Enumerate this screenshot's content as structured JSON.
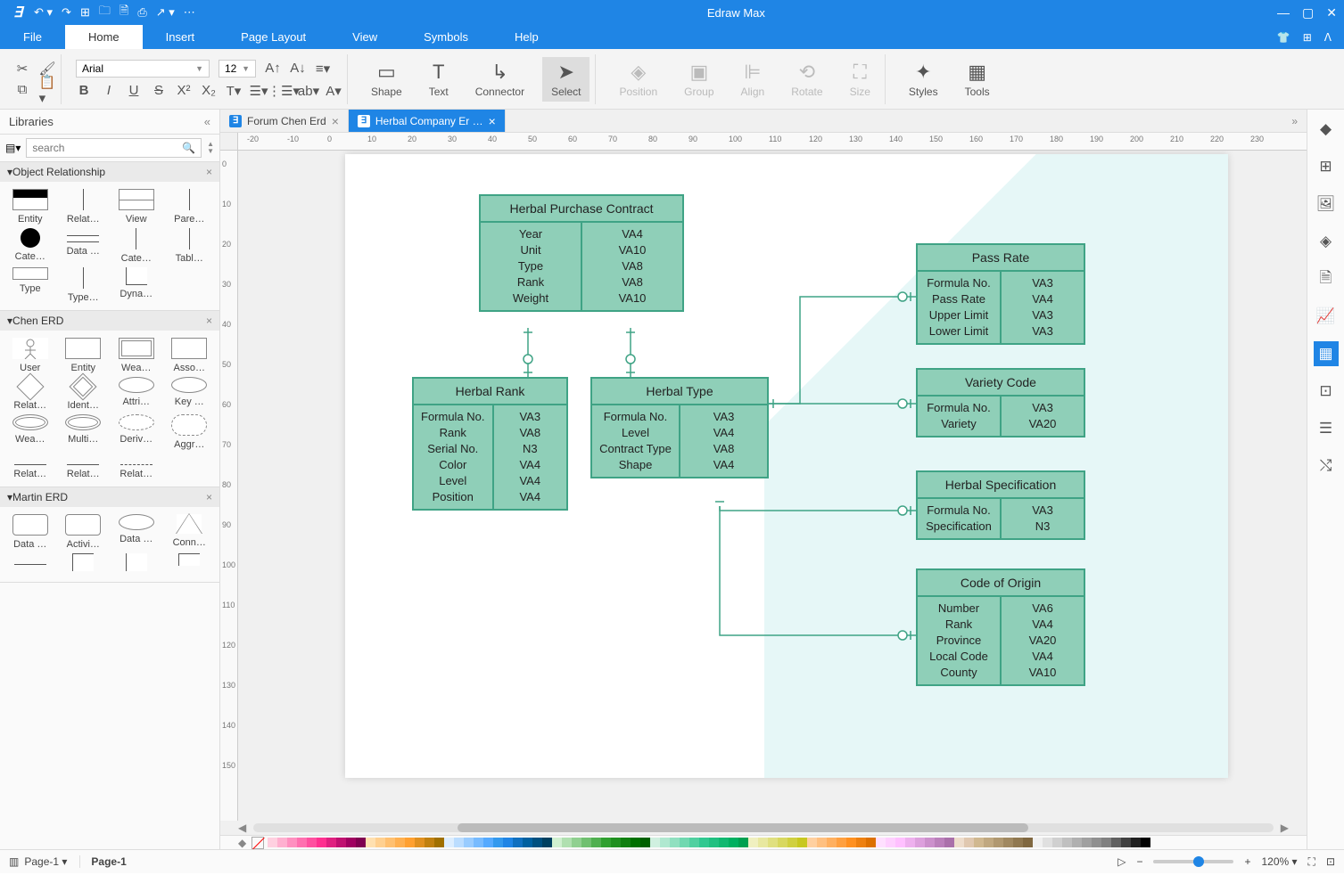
{
  "app_title": "Edraw Max",
  "menus": {
    "file": "File",
    "home": "Home",
    "insert": "Insert",
    "page_layout": "Page Layout",
    "view": "View",
    "symbols": "Symbols",
    "help": "Help"
  },
  "ribbon": {
    "font": "Arial",
    "font_size": "12",
    "shape": "Shape",
    "text": "Text",
    "connector": "Connector",
    "select": "Select",
    "position": "Position",
    "group": "Group",
    "align": "Align",
    "rotate": "Rotate",
    "size": "Size",
    "styles": "Styles",
    "tools": "Tools"
  },
  "libraries": {
    "title": "Libraries",
    "search_placeholder": "search",
    "sections": {
      "object_relationship": {
        "title": "Object Relationship",
        "items": [
          "Entity",
          "Relat…",
          "View",
          "Pare…",
          "Cate…",
          "Data …",
          "Cate…",
          "Tabl…",
          "Type",
          "Type…",
          "Dyna…"
        ]
      },
      "chen_erd": {
        "title": "Chen ERD",
        "items": [
          "User",
          "Entity",
          "Wea…",
          "Asso…",
          "Relat…",
          "Ident…",
          "Attri…",
          "Key …",
          "Wea…",
          "Multi…",
          "Deriv…",
          "Aggr…",
          "Relat…",
          "Relat…",
          "Relat…"
        ]
      },
      "martin_erd": {
        "title": "Martin ERD",
        "items": [
          "Data …",
          "Activi…",
          "Data …",
          "Conn…"
        ]
      }
    }
  },
  "doc_tabs": [
    {
      "label": "Forum Chen Erd",
      "active": false
    },
    {
      "label": "Herbal Company Er …",
      "active": true
    }
  ],
  "ruler_h": [
    "-20",
    "-10",
    "0",
    "10",
    "20",
    "30",
    "40",
    "50",
    "60",
    "70",
    "80",
    "90",
    "100",
    "110",
    "120",
    "130",
    "140",
    "150",
    "160",
    "170",
    "180",
    "190",
    "200",
    "210",
    "220",
    "230"
  ],
  "ruler_v": [
    "0",
    "10",
    "20",
    "30",
    "40",
    "50",
    "60",
    "70",
    "80",
    "90",
    "100",
    "110",
    "120",
    "130",
    "140",
    "150"
  ],
  "erd_tables": {
    "herbal_purchase": {
      "title": "Herbal Purchase Contract",
      "rows_left": [
        "Year",
        "Unit",
        "Type",
        "Rank",
        "Weight"
      ],
      "rows_right": [
        "VA4",
        "VA10",
        "VA8",
        "VA8",
        "VA10"
      ]
    },
    "herbal_rank": {
      "title": "Herbal Rank",
      "rows_left": [
        "Formula No.",
        "Rank",
        "Serial No.",
        "Color",
        "Level",
        "Position"
      ],
      "rows_right": [
        "VA3",
        "VA8",
        "N3",
        "VA4",
        "VA4",
        "VA4"
      ]
    },
    "herbal_type": {
      "title": "Herbal Type",
      "rows_left": [
        "Formula No.",
        "Level",
        "Contract Type",
        "Shape"
      ],
      "rows_right": [
        "VA3",
        "VA4",
        "VA8",
        "VA4"
      ]
    },
    "pass_rate": {
      "title": "Pass Rate",
      "rows_left": [
        "Formula No.",
        "Pass Rate",
        "Upper Limit",
        "Lower Limit"
      ],
      "rows_right": [
        "VA3",
        "VA4",
        "VA3",
        "VA3"
      ]
    },
    "variety_code": {
      "title": "Variety Code",
      "rows_left": [
        "Formula No.",
        "Variety"
      ],
      "rows_right": [
        "VA3",
        "VA20"
      ]
    },
    "herbal_spec": {
      "title": "Herbal Specification",
      "rows_left": [
        "Formula No.",
        "Specification"
      ],
      "rows_right": [
        "VA3",
        "N3"
      ]
    },
    "code_origin": {
      "title": "Code of Origin",
      "rows_left": [
        "Number",
        "Rank",
        "Province",
        "Local Code",
        "County"
      ],
      "rows_right": [
        "VA6",
        "VA4",
        "VA20",
        "VA4",
        "VA10"
      ]
    }
  },
  "status": {
    "page_select": "Page-1",
    "page_label": "Page-1",
    "zoom": "120%"
  },
  "palette_colors": [
    "#ffd0e0",
    "#ffb0d0",
    "#ff90c0",
    "#ff70b0",
    "#ff50a0",
    "#ff3090",
    "#e02080",
    "#c01070",
    "#a00060",
    "#800050",
    "#ffe0b0",
    "#ffd090",
    "#ffc070",
    "#ffb050",
    "#ffa030",
    "#e09020",
    "#c08010",
    "#a07000",
    "#ddeeff",
    "#bbddff",
    "#99ccff",
    "#77bbff",
    "#55aaff",
    "#3399ee",
    "#1f85e5",
    "#1070c0",
    "#0060a0",
    "#005080",
    "#004060",
    "#d0f0d0",
    "#b0e0b0",
    "#90d090",
    "#70c070",
    "#50b050",
    "#30a030",
    "#209020",
    "#108010",
    "#007000",
    "#006000",
    "#d0f0e0",
    "#b0e8d0",
    "#90e0c0",
    "#70d8b0",
    "#50d0a0",
    "#30c890",
    "#20c080",
    "#10b870",
    "#00b060",
    "#00a050",
    "#f0f0c0",
    "#e8e8a0",
    "#e0e080",
    "#d8d860",
    "#d0d040",
    "#c8c820",
    "#ffd0a0",
    "#ffc080",
    "#ffb060",
    "#ffa040",
    "#ff9020",
    "#ee8010",
    "#dd7000",
    "#ffe0ff",
    "#ffd0ff",
    "#ffc0ff",
    "#eeb0ee",
    "#dda0dd",
    "#cc90cc",
    "#bb80bb",
    "#aa70aa",
    "#eeddcc",
    "#e0c8b0",
    "#d0b890",
    "#c0a880",
    "#b09870",
    "#a08860",
    "#907850",
    "#806840",
    "#f0f0f0",
    "#e0e0e0",
    "#d0d0d0",
    "#c0c0c0",
    "#b0b0b0",
    "#a0a0a0",
    "#909090",
    "#808080",
    "#606060",
    "#404040",
    "#202020",
    "#000000"
  ]
}
